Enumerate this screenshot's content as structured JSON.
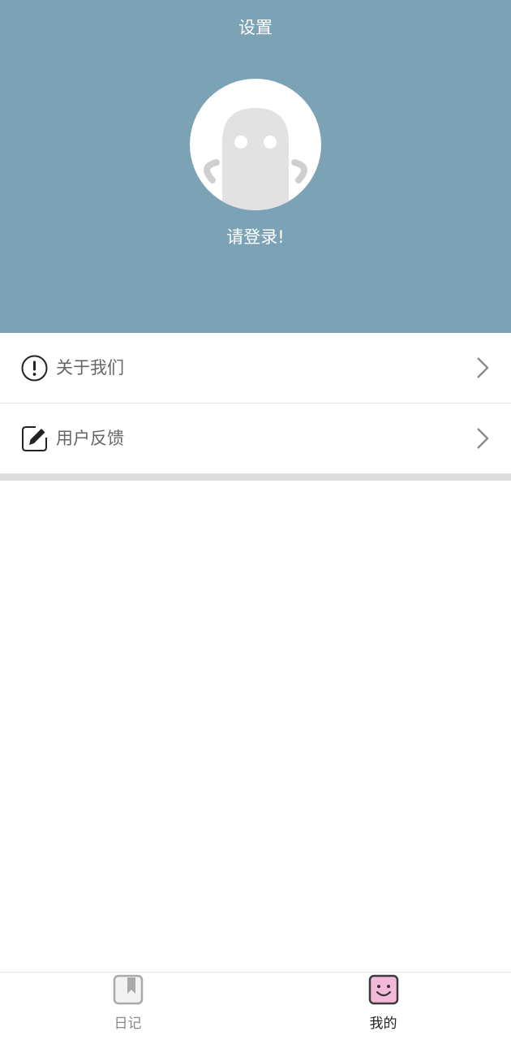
{
  "header": {
    "title": "设置",
    "login_prompt": "请登录!",
    "avatar_icon": "ghost-avatar-icon",
    "background_color": "#7ba2b5"
  },
  "menu": {
    "items": [
      {
        "label": "关于我们",
        "icon": "info-circle-icon"
      },
      {
        "label": "用户反馈",
        "icon": "edit-icon"
      }
    ]
  },
  "tabbar": {
    "tabs": [
      {
        "label": "日记",
        "icon": "diary-book-icon",
        "active": false
      },
      {
        "label": "我的",
        "icon": "smiley-face-icon",
        "active": true
      }
    ]
  }
}
